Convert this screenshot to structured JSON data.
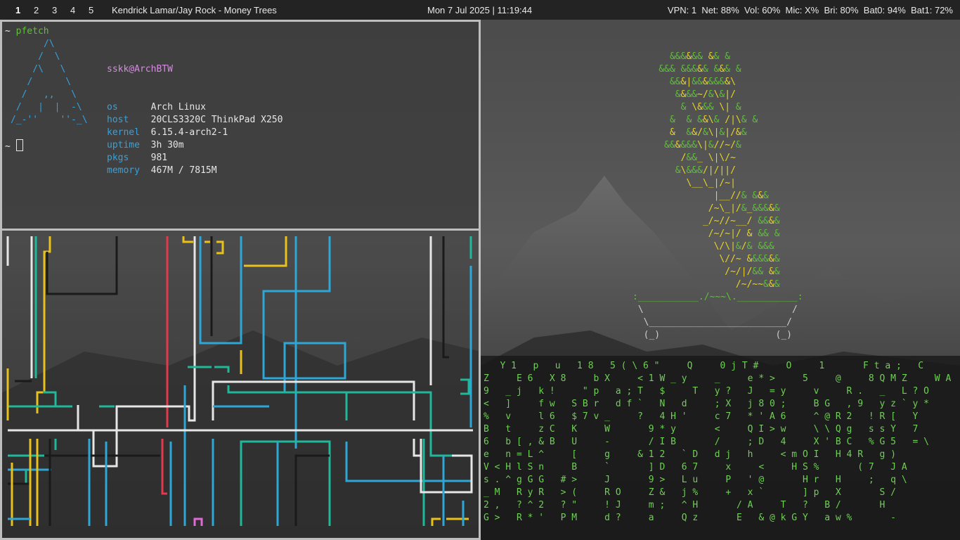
{
  "bar": {
    "workspaces": [
      "1",
      "2",
      "3",
      "4",
      "5"
    ],
    "active_workspace": "1",
    "window_title": "Kendrick Lamar/Jay Rock  -  Money Trees",
    "clock": "Mon  7 Jul 2025  | 11:19:44",
    "status": "VPN: 1  Net: 88%  Vol: 60%  Mic: X%  Bri: 80%  Bat0: 94%  Bat1: 72%"
  },
  "pfetch": {
    "prompt": "~",
    "command": "pfetch",
    "logo": [
      "      /\\",
      "     /  \\",
      "    /\\   \\",
      "   /      \\",
      "  /   ,,   \\",
      " /   |  |  -\\",
      "/_-''    ''-_\\"
    ],
    "user_host": "sskk@ArchBTW",
    "fields": [
      {
        "label": "os",
        "value": "Arch Linux"
      },
      {
        "label": "host",
        "value": "20CLS3320C ThinkPad X250"
      },
      {
        "label": "kernel",
        "value": "6.15.4-arch2-1"
      },
      {
        "label": "uptime",
        "value": "3h 30m"
      },
      {
        "label": "pkgs",
        "value": "981"
      },
      {
        "label": "memory",
        "value": "467M / 7815M"
      }
    ],
    "prompt2": "~"
  },
  "pipes": {
    "colors": {
      "white": "#e6e6e6",
      "yellow": "#e8c11c",
      "blue": "#2ea7d6",
      "teal": "#1fb89a",
      "red": "#e23a4c",
      "black": "#1a1a1a",
      "pink": "#e06ad8"
    }
  },
  "bonsai": {
    "tree": [
      "      &&&&&& && &",
      "    &&& &&&&& &&& &",
      "      &&&|&&&&&&&\\",
      "       &&&&~/&\\&|/",
      "        & \\&&& \\| &",
      "      &  & &&\\& /|\\& &",
      "      &  &&/&\\|&|/&&",
      "     &&&&&&\\|&//~/&",
      "        /&&_ \\|\\/~",
      "       &\\&&&/|/||/",
      "         \\__\\_|/~|",
      "              |__//& &&&",
      "             /~\\_|/&_&&&&&",
      "            _/~//~__/ &&&&",
      "             /~/~|/ & && &",
      "              \\/\\|&/& &&&",
      "               \\//~ &&&&&&",
      "                /~/|/&& &&",
      "                  /~/~~&&&"
    ],
    "pot": [
      ":___________./~~~\\.___________:",
      " \\                           /",
      "  \\_________________________/",
      "  (_)                     (_)"
    ]
  },
  "matrix": {
    "lines": [
      "   Y 1   p   u   1 8   5 ( \\ 6 \"     Q     0 j T #     O     1       F t a ;   C",
      "Z     E 6   X 8     b X     < 1 W _ y     _     e * >     5     @     8 Q M Z     W A",
      "9   _ j   k !     \" p   a ; T   $     T   y ?   J   = y     v     R .   _   L ? O",
      "<   ]     f w   S B r   d f `   N   d     ; X   j 8 0 ;     B G   , 9   y z ` y *",
      "%   v     l 6   $ 7 v _     ?   4 H '     c 7   * ' A 6     ^ @ R 2   ! R [   Y",
      "B   t     z C   K     W       9 * y       <     Q I > w     \\ \\ Q g   s s Y   7",
      "6   b [ , & B   U     -       / I B       /     ; D   4     X ' B C   % G 5   = \\",
      "e   n = L ^     [     g     & 1 2   ` D   d j   h     < m O I   H 4 R   g )",
      "V < H l S n     B     `       ] D   6 7     x     <     H S %       ( 7   J A",
      "s . ^ g G G   # >     J       9 >   L u     P   ' @       H r   H     ;   q \\",
      "_ M   R y R   > (     R O     Z &   j %     +   x `       ] p   X       S /",
      "2 ,   ? ^ 2   ? \"     ! J     m ;   ^ H       / A     T   ?   B /       H",
      "G >   R * '   P M     d ?     a     Q z       E   & @ k G Y   a w %       -"
    ]
  }
}
